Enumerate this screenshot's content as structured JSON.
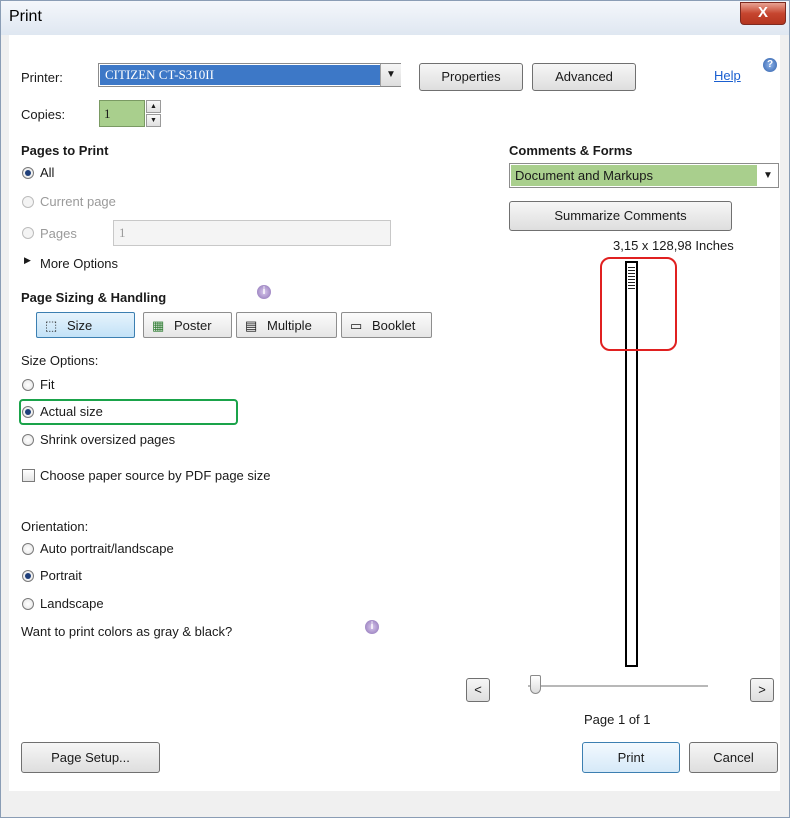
{
  "window": {
    "title": "Print",
    "close_label": "X"
  },
  "printer": {
    "label": "Printer:",
    "value": "CITIZEN CT-S310II",
    "properties_label": "Properties",
    "advanced_label": "Advanced",
    "help_label": "Help"
  },
  "copies": {
    "label": "Copies:",
    "value": "1"
  },
  "pages_to_print": {
    "heading": "Pages to Print",
    "all_label": "All",
    "current_label": "Current page",
    "pages_label": "Pages",
    "pages_value": "1",
    "more_options_label": "More Options"
  },
  "sizing": {
    "heading": "Page Sizing & Handling",
    "size_label": "Size",
    "poster_label": "Poster",
    "multiple_label": "Multiple",
    "booklet_label": "Booklet",
    "size_options_label": "Size Options:",
    "fit_label": "Fit",
    "actual_label": "Actual size",
    "shrink_label": "Shrink oversized pages",
    "paper_source_label": "Choose paper source by PDF page size"
  },
  "orientation": {
    "label": "Orientation:",
    "auto_label": "Auto portrait/landscape",
    "portrait_label": "Portrait",
    "landscape_label": "Landscape",
    "gray_label": "Want to print colors as gray & black?"
  },
  "comments": {
    "heading": "Comments & Forms",
    "value": "Document and Markups",
    "summarize_label": "Summarize Comments"
  },
  "preview": {
    "dimensions": "3,15 x 128,98 Inches",
    "prev_label": "<",
    "next_label": ">",
    "page_indicator": "Page 1 of 1",
    "slider_position": 0
  },
  "footer": {
    "page_setup_label": "Page Setup...",
    "print_label": "Print",
    "cancel_label": "Cancel"
  },
  "colors": {
    "field_highlight": "#a9cf8d",
    "red_annotation": "#e02020",
    "green_annotation": "#1aa34a"
  }
}
